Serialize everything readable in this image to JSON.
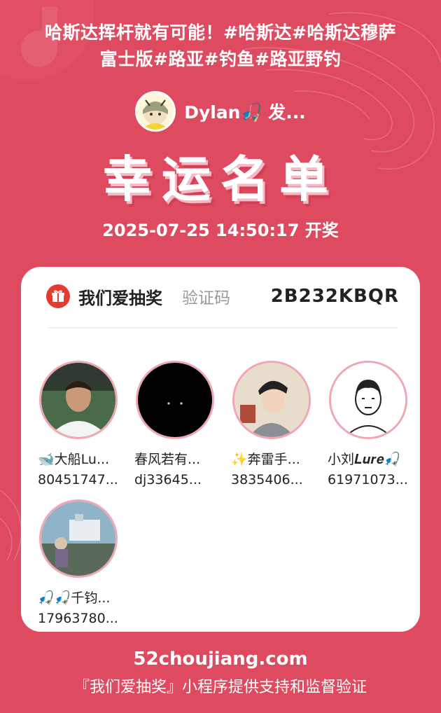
{
  "headline": {
    "line1": "哈斯达挥杆就有可能！#哈斯达#哈斯达穆萨",
    "line2": "富士版#路亚#钓鱼#路亚野钓"
  },
  "author": {
    "name": "Dylan🎣 发..."
  },
  "title": "幸运名单",
  "draw_time": "2025-07-25 14:50:17 开奖",
  "card": {
    "brand": "我们爱抽奖",
    "verify_label": "验证码",
    "verify_code": "2B232KBQR",
    "winners": [
      {
        "name": "🐋大船Lu...",
        "id": "80451747..."
      },
      {
        "name": "春风若有...",
        "id": "dj33645..."
      },
      {
        "name": "✨奔雷手...",
        "id": "3835406..."
      },
      {
        "name": "小刘𝑳𝒖𝒓𝒆🎣",
        "id": "61971073..."
      },
      {
        "name": "🎣🎣千钧...",
        "id": "17963780..."
      }
    ]
  },
  "footer": {
    "site": "52choujiang.com",
    "note": "『我们爱抽奖』小程序提供支持和监督验证"
  },
  "colors": {
    "background": "#de4a5f",
    "avatar_ring": "#f1a7b3",
    "brand_icon": "#e33c2f"
  }
}
